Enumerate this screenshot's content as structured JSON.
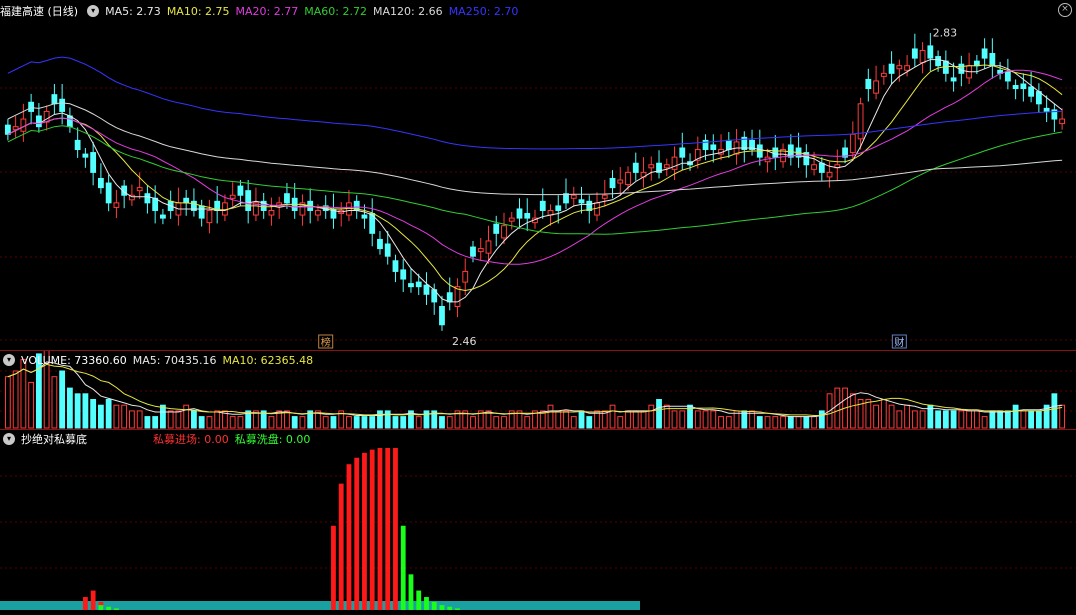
{
  "main_panel": {
    "title": "福建高速 (日线)",
    "ma5": "MA5: 2.73",
    "ma10": "MA10: 2.75",
    "ma20": "MA20: 2.77",
    "ma60": "MA60: 2.72",
    "ma120": "MA120: 2.66",
    "ma250": "MA250: 2.70",
    "high_label": "2.83",
    "low_label": "2.46",
    "marker_1": "榜",
    "marker_2": "财",
    "close_symbol": "×"
  },
  "volume_panel": {
    "volume": "VOLUME: 73360.60",
    "ma5": "MA5: 70435.16",
    "ma10": "MA10: 62365.48"
  },
  "indicator_panel": {
    "title": "抄绝对私募底",
    "entry": "私募进场: 0.00",
    "washout": "私募洗盘: 0.00"
  },
  "colors": {
    "up": "#ff3b3b",
    "down": "#54ffff",
    "ma5": "#e8e8e8",
    "ma10": "#e6e642",
    "ma20": "#e03ce0",
    "ma60": "#32cd32",
    "ma120": "#d8d8d8",
    "ma250": "#3535ff",
    "grid": "#5a0000"
  },
  "chart_data": [
    {
      "type": "candlestick",
      "title": "福建高速 (日线)",
      "annotations": [
        {
          "label": "2.83",
          "kind": "high"
        },
        {
          "label": "2.46",
          "kind": "low"
        }
      ],
      "series": [
        {
          "name": "MA5",
          "last": 2.73
        },
        {
          "name": "MA10",
          "last": 2.75
        },
        {
          "name": "MA20",
          "last": 2.77
        },
        {
          "name": "MA60",
          "last": 2.72
        },
        {
          "name": "MA120",
          "last": 2.66
        },
        {
          "name": "MA250",
          "last": 2.7
        }
      ],
      "close": [
        2.71,
        2.72,
        2.73,
        2.74,
        2.72,
        2.74,
        2.75,
        2.74,
        2.72,
        2.69,
        2.68,
        2.66,
        2.64,
        2.62,
        2.62,
        2.63,
        2.63,
        2.64,
        2.62,
        2.61,
        2.6,
        2.61,
        2.62,
        2.62,
        2.61,
        2.6,
        2.61,
        2.61,
        2.62,
        2.63,
        2.63,
        2.61,
        2.62,
        2.61,
        2.61,
        2.62,
        2.62,
        2.61,
        2.62,
        2.61,
        2.61,
        2.61,
        2.6,
        2.61,
        2.62,
        2.61,
        2.6,
        2.58,
        2.56,
        2.55,
        2.53,
        2.52,
        2.51,
        2.51,
        2.5,
        2.49,
        2.46,
        2.49,
        2.51,
        2.53,
        2.55,
        2.56,
        2.57,
        2.58,
        2.59,
        2.6,
        2.6,
        2.6,
        2.6,
        2.61,
        2.61,
        2.61,
        2.62,
        2.63,
        2.62,
        2.61,
        2.62,
        2.63,
        2.64,
        2.65,
        2.66,
        2.66,
        2.66,
        2.67,
        2.66,
        2.67,
        2.68,
        2.68,
        2.67,
        2.69,
        2.69,
        2.69,
        2.69,
        2.69,
        2.7,
        2.69,
        2.69,
        2.68,
        2.68,
        2.68,
        2.69,
        2.68,
        2.68,
        2.67,
        2.67,
        2.66,
        2.66,
        2.67,
        2.68,
        2.71,
        2.75,
        2.77,
        2.78,
        2.79,
        2.79,
        2.8,
        2.8,
        2.81,
        2.82,
        2.81,
        2.8,
        2.79,
        2.78,
        2.79,
        2.8,
        2.8,
        2.81,
        2.8,
        2.79,
        2.78,
        2.77,
        2.77,
        2.76,
        2.75,
        2.74,
        2.73,
        2.73
      ],
      "volume": [
        0.9,
        1.0,
        1.2,
        0.8,
        1.3,
        1.5,
        0.9,
        1.0,
        0.7,
        0.6,
        0.6,
        0.5,
        0.4,
        0.5,
        0.4,
        0.4,
        0.3,
        0.3,
        0.2,
        0.2,
        0.4,
        0.3,
        0.3,
        0.4,
        0.3,
        0.2,
        0.2,
        0.3,
        0.3,
        0.2,
        0.2,
        0.3,
        0.3,
        0.3,
        0.2,
        0.3,
        0.3,
        0.2,
        0.2,
        0.3,
        0.3,
        0.2,
        0.2,
        0.3,
        0.2,
        0.2,
        0.2,
        0.2,
        0.3,
        0.3,
        0.2,
        0.2,
        0.3,
        0.2,
        0.3,
        0.3,
        0.2,
        0.2,
        0.3,
        0.3,
        0.2,
        0.3,
        0.3,
        0.2,
        0.2,
        0.3,
        0.3,
        0.2,
        0.3,
        0.3,
        0.4,
        0.3,
        0.3,
        0.2,
        0.3,
        0.2,
        0.3,
        0.3,
        0.4,
        0.2,
        0.3,
        0.3,
        0.3,
        0.4,
        0.5,
        0.4,
        0.3,
        0.3,
        0.4,
        0.3,
        0.3,
        0.3,
        0.2,
        0.2,
        0.3,
        0.3,
        0.3,
        0.2,
        0.2,
        0.2,
        0.2,
        0.2,
        0.2,
        0.2,
        0.2,
        0.3,
        0.6,
        0.7,
        0.7,
        0.6,
        0.5,
        0.5,
        0.4,
        0.5,
        0.4,
        0.3,
        0.4,
        0.3,
        0.3,
        0.4,
        0.3,
        0.3,
        0.3,
        0.3,
        0.3,
        0.3,
        0.2,
        0.3,
        0.3,
        0.3,
        0.4,
        0.3,
        0.3,
        0.3,
        0.4,
        0.6,
        0.4
      ],
      "indicator_entry": [
        0,
        0,
        0,
        0,
        0,
        0,
        0,
        0,
        0,
        0,
        0.08,
        0.12,
        0.05,
        0,
        0,
        0,
        0,
        0,
        0,
        0,
        0,
        0,
        0,
        0,
        0,
        0,
        0,
        0,
        0,
        0,
        0,
        0,
        0,
        0,
        0,
        0,
        0,
        0,
        0,
        0,
        0,
        0,
        0.52,
        0.78,
        0.9,
        0.94,
        0.97,
        0.99,
        1.0,
        1.0,
        1.0,
        0,
        0,
        0,
        0,
        0,
        0,
        0,
        0,
        0,
        0,
        0,
        0,
        0,
        0,
        0,
        0,
        0,
        0,
        0,
        0,
        0,
        0,
        0,
        0,
        0,
        0,
        0,
        0,
        0,
        0,
        0,
        0,
        0,
        0,
        0,
        0,
        0,
        0,
        0,
        0,
        0,
        0,
        0,
        0,
        0,
        0,
        0,
        0,
        0,
        0,
        0,
        0,
        0,
        0,
        0,
        0,
        0,
        0,
        0,
        0,
        0,
        0,
        0,
        0,
        0,
        0,
        0,
        0,
        0,
        0,
        0,
        0,
        0,
        0,
        0,
        0,
        0,
        0,
        0,
        0,
        0,
        0,
        0,
        0,
        0,
        0,
        0,
        0
      ],
      "indicator_washout": [
        0,
        0,
        0,
        0,
        0,
        0,
        0,
        0,
        0,
        0,
        0,
        0,
        0.03,
        0.02,
        0.01,
        0,
        0,
        0,
        0,
        0,
        0,
        0,
        0,
        0,
        0,
        0,
        0,
        0,
        0,
        0,
        0,
        0,
        0,
        0,
        0,
        0,
        0,
        0,
        0,
        0,
        0,
        0,
        0,
        0,
        0,
        0,
        0,
        0,
        0,
        0,
        0,
        0.52,
        0.22,
        0.12,
        0.08,
        0.05,
        0.03,
        0.02,
        0.01,
        0,
        0,
        0,
        0,
        0,
        0,
        0,
        0,
        0,
        0,
        0,
        0,
        0,
        0,
        0,
        0,
        0,
        0,
        0,
        0,
        0,
        0,
        0,
        0,
        0,
        0,
        0,
        0,
        0,
        0,
        0,
        0,
        0,
        0,
        0,
        0,
        0,
        0,
        0,
        0,
        0,
        0,
        0,
        0,
        0,
        0,
        0,
        0,
        0,
        0,
        0,
        0,
        0,
        0,
        0,
        0,
        0,
        0,
        0,
        0,
        0,
        0,
        0,
        0,
        0,
        0,
        0,
        0,
        0,
        0,
        0,
        0,
        0,
        0,
        0,
        0,
        0,
        0
      ]
    }
  ]
}
